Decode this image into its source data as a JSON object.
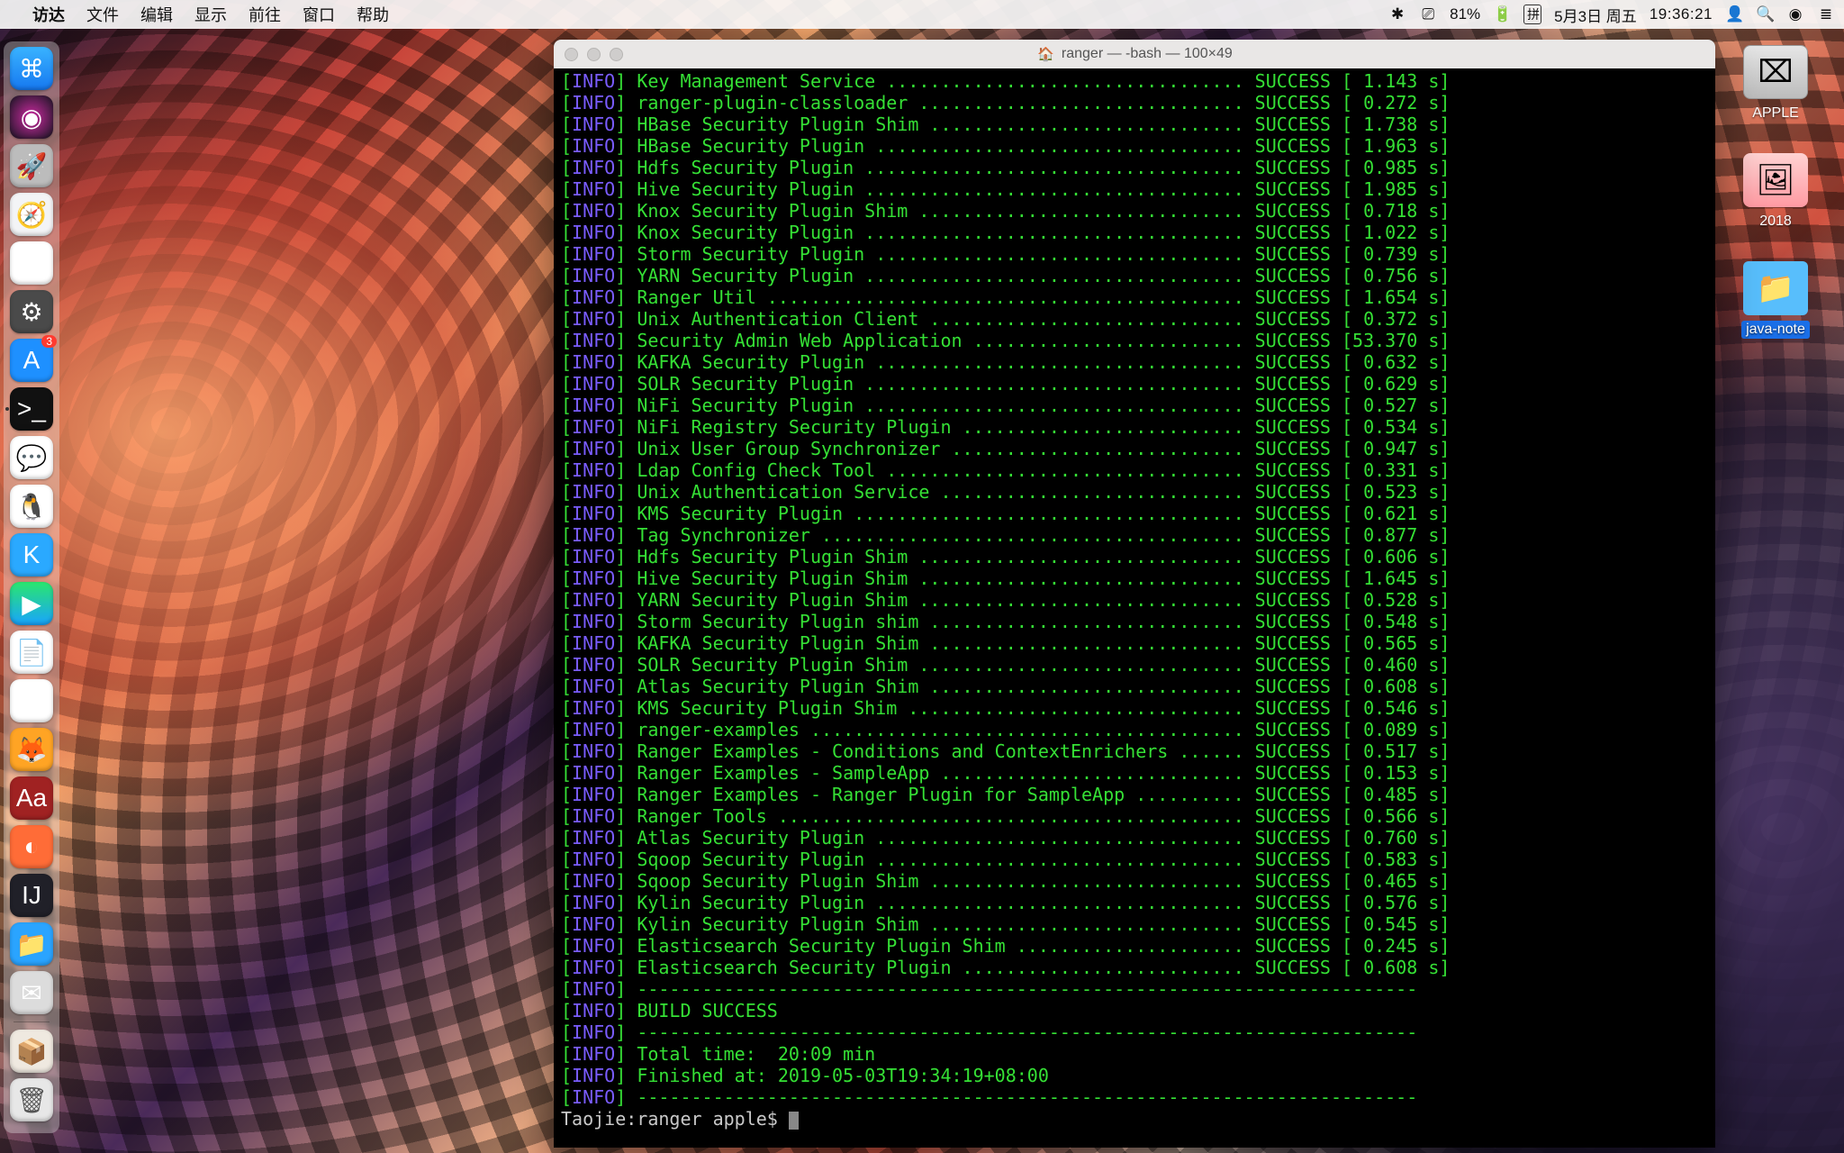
{
  "menubar": {
    "apple": "",
    "items": [
      "访达",
      "文件",
      "编辑",
      "显示",
      "前往",
      "窗口",
      "帮助"
    ],
    "status": {
      "bluetooth": "",
      "airplay": "⎚",
      "battery_pct": "81%",
      "battery_icon": "⚡",
      "ime": "拼",
      "date": "5月3日 周五",
      "time": "19:36:21",
      "user": "👤",
      "spotlight": "🔍",
      "siri": "◉",
      "menu": "≣"
    }
  },
  "dock": {
    "items": [
      {
        "name": "finder",
        "glyph": "⌘",
        "bg": "linear-gradient(#39b3ff,#1678f0)"
      },
      {
        "name": "siri",
        "glyph": "◉",
        "bg": "radial-gradient(circle,#cc2aa0,#151520)"
      },
      {
        "name": "launchpad",
        "glyph": "🚀",
        "bg": "#bcbcbc"
      },
      {
        "name": "safari",
        "glyph": "🧭",
        "bg": "#f3f4f6"
      },
      {
        "name": "photos",
        "glyph": "✿",
        "bg": "#fff"
      },
      {
        "name": "settings",
        "glyph": "⚙",
        "bg": "#4a4a4a"
      },
      {
        "name": "appstore",
        "glyph": "A",
        "bg": "#1e90ff",
        "badge": "3"
      },
      {
        "name": "terminal",
        "glyph": ">_",
        "bg": "#111",
        "active": true
      },
      {
        "name": "wechat",
        "glyph": "💬",
        "bg": "#fff"
      },
      {
        "name": "qq",
        "glyph": "🐧",
        "bg": "#fff"
      },
      {
        "name": "k",
        "glyph": "K",
        "bg": "#2aa9ff"
      },
      {
        "name": "video",
        "glyph": "▶",
        "bg": "linear-gradient(#2ae66d,#18a4ff)"
      },
      {
        "name": "textedit",
        "glyph": "📄",
        "bg": "#fff"
      },
      {
        "name": "music",
        "glyph": "♫",
        "bg": "#fff"
      },
      {
        "name": "firefox",
        "glyph": "🦊",
        "bg": "#ffa424"
      },
      {
        "name": "dict",
        "glyph": "Aa",
        "bg": "#a02222"
      },
      {
        "name": "postman",
        "glyph": "◐",
        "bg": "#ff6c37"
      },
      {
        "name": "intellij",
        "glyph": "IJ",
        "bg": "#202028"
      },
      {
        "name": "finder2",
        "glyph": "📁",
        "bg": "#2aa4ff"
      },
      {
        "name": "mail",
        "glyph": "✉",
        "bg": "#dcdcdc"
      }
    ],
    "tail": [
      {
        "name": "jar",
        "glyph": "📦",
        "bg": "#efe9e0"
      },
      {
        "name": "trash",
        "glyph": "🗑",
        "bg": "#e7e7e7"
      }
    ]
  },
  "desktop": {
    "items": [
      {
        "name": "disk",
        "label": "APPLE",
        "kind": "disk"
      },
      {
        "name": "img",
        "label": "2018",
        "kind": "image"
      },
      {
        "name": "folder",
        "label": "java-note",
        "kind": "folder",
        "selected": true
      }
    ]
  },
  "terminal": {
    "title": "ranger — -bash — 100×49",
    "rows": [
      {
        "module": "Key Management Service",
        "status": "SUCCESS",
        "time": "1.143 s"
      },
      {
        "module": "ranger-plugin-classloader",
        "status": "SUCCESS",
        "time": "0.272 s"
      },
      {
        "module": "HBase Security Plugin Shim",
        "status": "SUCCESS",
        "time": "1.738 s"
      },
      {
        "module": "HBase Security Plugin",
        "status": "SUCCESS",
        "time": "1.963 s"
      },
      {
        "module": "Hdfs Security Plugin",
        "status": "SUCCESS",
        "time": "0.985 s"
      },
      {
        "module": "Hive Security Plugin",
        "status": "SUCCESS",
        "time": "1.985 s"
      },
      {
        "module": "Knox Security Plugin Shim",
        "status": "SUCCESS",
        "time": "0.718 s"
      },
      {
        "module": "Knox Security Plugin",
        "status": "SUCCESS",
        "time": "1.022 s"
      },
      {
        "module": "Storm Security Plugin",
        "status": "SUCCESS",
        "time": "0.739 s"
      },
      {
        "module": "YARN Security Plugin",
        "status": "SUCCESS",
        "time": "0.756 s"
      },
      {
        "module": "Ranger Util",
        "status": "SUCCESS",
        "time": "1.654 s"
      },
      {
        "module": "Unix Authentication Client",
        "status": "SUCCESS",
        "time": "0.372 s"
      },
      {
        "module": "Security Admin Web Application",
        "status": "SUCCESS",
        "time": "53.370 s"
      },
      {
        "module": "KAFKA Security Plugin",
        "status": "SUCCESS",
        "time": "0.632 s"
      },
      {
        "module": "SOLR Security Plugin",
        "status": "SUCCESS",
        "time": "0.629 s"
      },
      {
        "module": "NiFi Security Plugin",
        "status": "SUCCESS",
        "time": "0.527 s"
      },
      {
        "module": "NiFi Registry Security Plugin",
        "status": "SUCCESS",
        "time": "0.534 s"
      },
      {
        "module": "Unix User Group Synchronizer",
        "status": "SUCCESS",
        "time": "0.947 s"
      },
      {
        "module": "Ldap Config Check Tool",
        "status": "SUCCESS",
        "time": "0.331 s"
      },
      {
        "module": "Unix Authentication Service",
        "status": "SUCCESS",
        "time": "0.523 s"
      },
      {
        "module": "KMS Security Plugin",
        "status": "SUCCESS",
        "time": "0.621 s"
      },
      {
        "module": "Tag Synchronizer",
        "status": "SUCCESS",
        "time": "0.877 s"
      },
      {
        "module": "Hdfs Security Plugin Shim",
        "status": "SUCCESS",
        "time": "0.606 s"
      },
      {
        "module": "Hive Security Plugin Shim",
        "status": "SUCCESS",
        "time": "1.645 s"
      },
      {
        "module": "YARN Security Plugin Shim",
        "status": "SUCCESS",
        "time": "0.528 s"
      },
      {
        "module": "Storm Security Plugin shim",
        "status": "SUCCESS",
        "time": "0.548 s"
      },
      {
        "module": "KAFKA Security Plugin Shim",
        "status": "SUCCESS",
        "time": "0.565 s"
      },
      {
        "module": "SOLR Security Plugin Shim",
        "status": "SUCCESS",
        "time": "0.460 s"
      },
      {
        "module": "Atlas Security Plugin Shim",
        "status": "SUCCESS",
        "time": "0.608 s"
      },
      {
        "module": "KMS Security Plugin Shim",
        "status": "SUCCESS",
        "time": "0.546 s"
      },
      {
        "module": "ranger-examples",
        "status": "SUCCESS",
        "time": "0.089 s"
      },
      {
        "module": "Ranger Examples - Conditions and ContextEnrichers",
        "status": "SUCCESS",
        "time": "0.517 s"
      },
      {
        "module": "Ranger Examples - SampleApp",
        "status": "SUCCESS",
        "time": "0.153 s"
      },
      {
        "module": "Ranger Examples - Ranger Plugin for SampleApp",
        "status": "SUCCESS",
        "time": "0.485 s"
      },
      {
        "module": "Ranger Tools",
        "status": "SUCCESS",
        "time": "0.566 s"
      },
      {
        "module": "Atlas Security Plugin",
        "status": "SUCCESS",
        "time": "0.760 s"
      },
      {
        "module": "Sqoop Security Plugin",
        "status": "SUCCESS",
        "time": "0.583 s"
      },
      {
        "module": "Sqoop Security Plugin Shim",
        "status": "SUCCESS",
        "time": "0.465 s"
      },
      {
        "module": "Kylin Security Plugin",
        "status": "SUCCESS",
        "time": "0.576 s"
      },
      {
        "module": "Kylin Security Plugin Shim",
        "status": "SUCCESS",
        "time": "0.545 s"
      },
      {
        "module": "Elasticsearch Security Plugin Shim",
        "status": "SUCCESS",
        "time": "0.245 s"
      },
      {
        "module": "Elasticsearch Security Plugin",
        "status": "SUCCESS",
        "time": "0.608 s"
      }
    ],
    "tail": {
      "build": "BUILD SUCCESS",
      "total": "Total time:  20:09 min",
      "finished": "Finished at: 2019-05-03T19:34:19+08:00"
    },
    "prompt": {
      "host": "Taojie",
      "path": "ranger",
      "user": "apple",
      "sym": "$"
    }
  }
}
